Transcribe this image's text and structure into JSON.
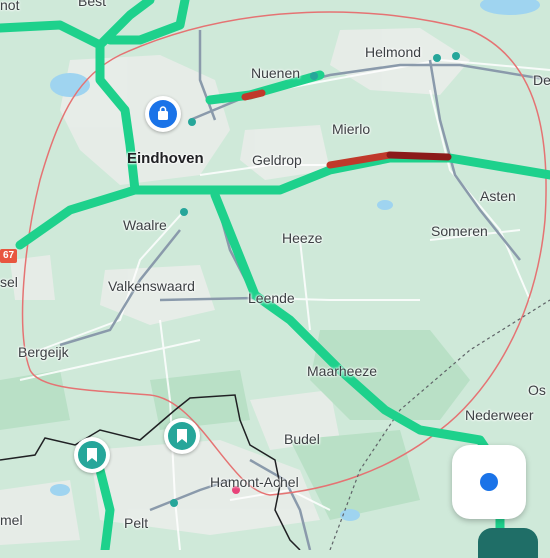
{
  "map": {
    "places": [
      {
        "id": "best",
        "label": "Best"
      },
      {
        "id": "not",
        "label": "not"
      },
      {
        "id": "nuenen",
        "label": "Nuenen"
      },
      {
        "id": "helmond",
        "label": "Helmond"
      },
      {
        "id": "de",
        "label": "De"
      },
      {
        "id": "eindhoven",
        "label": "Eindhoven"
      },
      {
        "id": "mierlo",
        "label": "Mierlo"
      },
      {
        "id": "geldrop",
        "label": "Geldrop"
      },
      {
        "id": "asten",
        "label": "Asten"
      },
      {
        "id": "waalre",
        "label": "Waalre"
      },
      {
        "id": "heeze",
        "label": "Heeze"
      },
      {
        "id": "someren",
        "label": "Someren"
      },
      {
        "id": "sel",
        "label": "sel"
      },
      {
        "id": "valkenswaard",
        "label": "Valkenswaard"
      },
      {
        "id": "leende",
        "label": "Leende"
      },
      {
        "id": "bergeijk",
        "label": "Bergeijk"
      },
      {
        "id": "maarheeze",
        "label": "Maarheeze"
      },
      {
        "id": "os",
        "label": "Os"
      },
      {
        "id": "nederweert",
        "label": "Nederweer"
      },
      {
        "id": "budel",
        "label": "Budel"
      },
      {
        "id": "hamont",
        "label": "Hamont-Achel"
      },
      {
        "id": "mel",
        "label": "mel"
      },
      {
        "id": "pelt",
        "label": "Pelt"
      }
    ],
    "road_shield": "67",
    "colors": {
      "land": "#cfe9d9",
      "highway": "#1ed18c",
      "traffic_slow": "#c0392b",
      "traffic_jam": "#8b1a1a",
      "border": "#202124",
      "search_area": "#e57373",
      "accent": "#1a73e8",
      "pin_teal": "#26a69a"
    },
    "icons": {
      "shopping": "shopping-bag-icon",
      "bookmark": "bookmark-icon",
      "my_location": "my-location-icon"
    }
  }
}
